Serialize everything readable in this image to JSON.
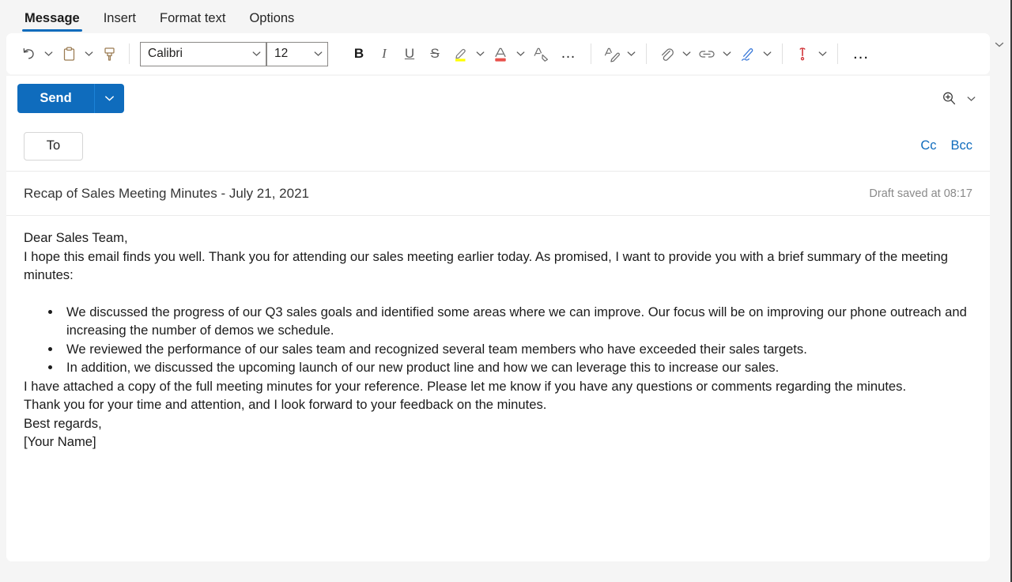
{
  "ribbon": {
    "tabs": [
      {
        "label": "Message",
        "active": true
      },
      {
        "label": "Insert",
        "active": false
      },
      {
        "label": "Format text",
        "active": false
      },
      {
        "label": "Options",
        "active": false
      }
    ],
    "collapse_icon": "chevron-down-icon"
  },
  "toolbar": {
    "undo_icon": "undo-icon",
    "paste_icon": "paste-icon",
    "format_painter_icon": "format-painter-icon",
    "font_family": "Calibri",
    "font_size": "12",
    "bold_label": "B",
    "italic_label": "I",
    "underline_label": "U",
    "strikethrough_label": "S",
    "highlight_icon": "highlight-pen-icon",
    "highlight_color": "#ffff00",
    "font_color_icon": "font-color-icon",
    "font_color": "#e8514a",
    "clear_formatting_icon": "clear-formatting-icon",
    "more_formatting_label": "…",
    "editor_icon": "editor-proofing-icon",
    "attach_icon": "paperclip-icon",
    "link_icon": "link-icon",
    "signature_icon": "signature-pen-icon",
    "importance_icon": "importance-icon",
    "overflow_label": "…"
  },
  "actions": {
    "send_label": "Send",
    "send_caret_icon": "chevron-down-icon",
    "zoom_icon": "zoom-in-icon",
    "zoom_caret_icon": "chevron-down-icon"
  },
  "compose": {
    "to_label": "To",
    "to_value": "",
    "to_placeholder": "",
    "cc_label": "Cc",
    "bcc_label": "Bcc",
    "subject_value": "Recap of Sales Meeting Minutes - July 21, 2021",
    "subject_placeholder": "Add a subject",
    "draft_status": "Draft saved at 08:17"
  },
  "body": {
    "greeting": "Dear Sales Team,",
    "intro": "I hope this email finds you well. Thank you for attending our sales meeting earlier today. As promised, I want to provide you with a brief summary of the meeting minutes:",
    "bullets": [
      "We discussed the progress of our Q3 sales goals and identified some areas where we can improve. Our focus will be on improving our phone outreach and increasing the number of demos we schedule.",
      "We reviewed the performance of our sales team and recognized several team members who have exceeded their sales targets.",
      "In addition, we discussed the upcoming launch of our new product line and how we can leverage this to increase our sales."
    ],
    "para_attachment": "I have attached a copy of the full meeting minutes for your reference. Please let me know if you have any questions or comments regarding the minutes.",
    "para_thanks": "Thank you for your time and attention, and I look forward to your feedback on the minutes.",
    "closing": "Best regards,",
    "signature": "[Your Name]"
  },
  "colors": {
    "accent": "#0f6cbd",
    "link": "#0f6cbd",
    "highlight": "#ffff00",
    "font_color": "#e8514a",
    "importance": "#d13438",
    "signature_blue": "#3b7ad9"
  }
}
